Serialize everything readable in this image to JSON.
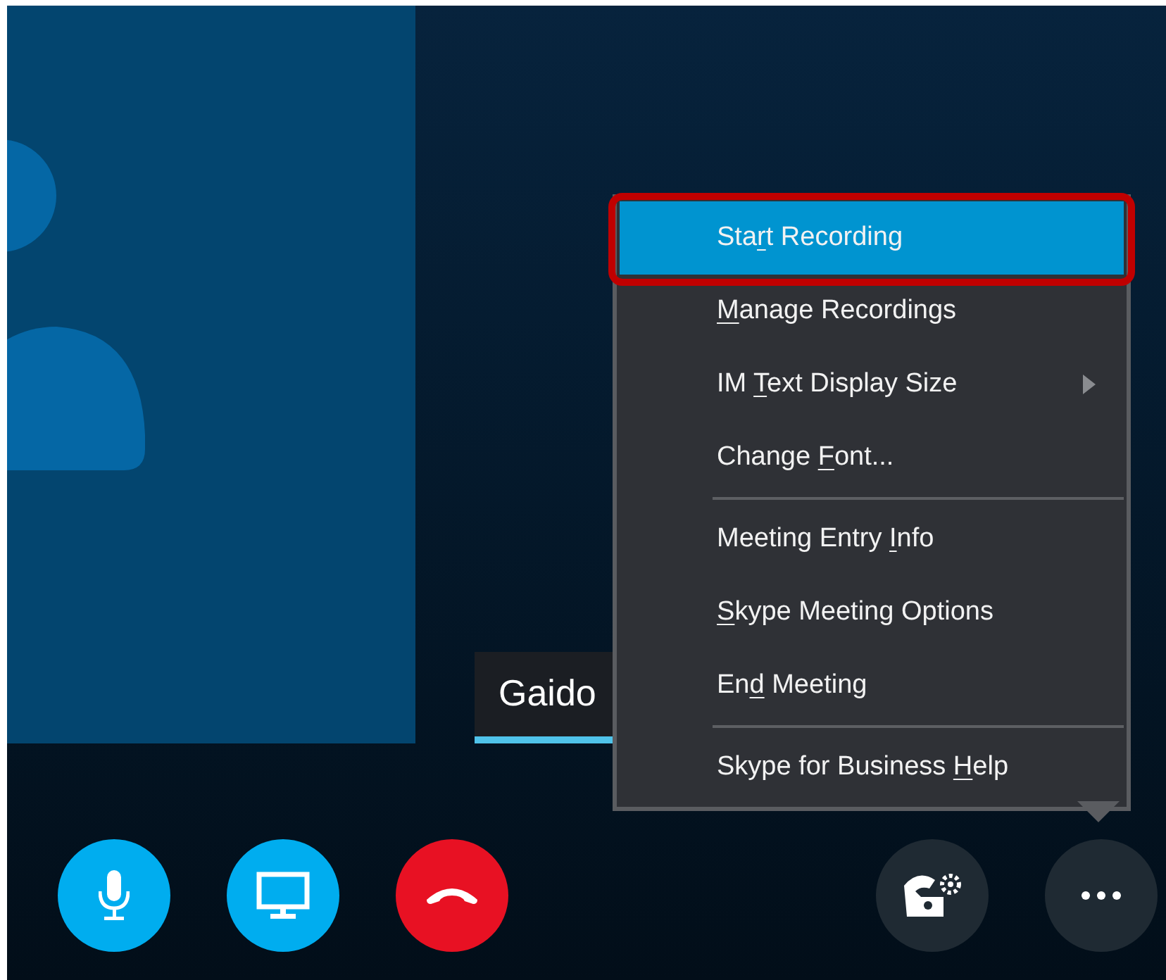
{
  "participant": {
    "name": "Gaido"
  },
  "menu": {
    "items": [
      {
        "kind": "item",
        "before": "Sta",
        "key": "r",
        "after": "t Recording",
        "selected": true,
        "submenu": false,
        "outlined": true
      },
      {
        "kind": "item",
        "key": "M",
        "after": "anage Recordings",
        "selected": false,
        "submenu": false,
        "outlined": false
      },
      {
        "kind": "item",
        "before": "IM ",
        "key": "T",
        "after": "ext Display Size",
        "selected": false,
        "submenu": true,
        "outlined": false
      },
      {
        "kind": "item",
        "before": "Change ",
        "key": "F",
        "after": "ont...",
        "selected": false,
        "submenu": false,
        "outlined": false
      },
      {
        "kind": "separator"
      },
      {
        "kind": "item",
        "before": "Meeting Entry ",
        "key": "I",
        "after": "nfo",
        "selected": false,
        "submenu": false,
        "outlined": false
      },
      {
        "kind": "item",
        "key": "S",
        "after": "kype Meeting Options",
        "selected": false,
        "submenu": false,
        "outlined": false
      },
      {
        "kind": "item",
        "before": "En",
        "key": "d",
        "after": " Meeting",
        "selected": false,
        "submenu": false,
        "outlined": false
      },
      {
        "kind": "separator"
      },
      {
        "kind": "item",
        "before": "Skype for Business ",
        "key": "H",
        "after": "elp",
        "selected": false,
        "submenu": false,
        "outlined": false
      }
    ]
  },
  "controls": [
    {
      "kind": "mic"
    },
    {
      "kind": "screen"
    },
    {
      "kind": "hangup"
    },
    {
      "kind": "spacer"
    },
    {
      "kind": "dialpad"
    },
    {
      "kind": "more"
    }
  ]
}
